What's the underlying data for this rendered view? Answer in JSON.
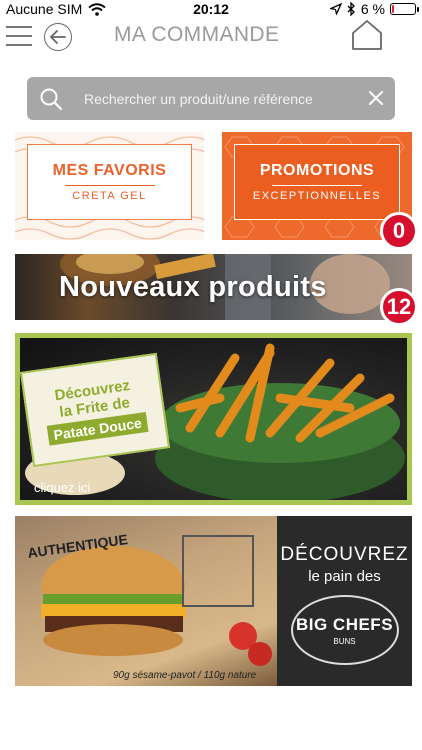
{
  "status": {
    "carrier": "Aucune SIM",
    "time": "20:12",
    "battery_pct_text": "6 %",
    "battery_level": 0.06,
    "battery_color": "#e0242b"
  },
  "header": {
    "title": "MA COMMANDE",
    "icons": [
      "menu-icon",
      "back-arrow-icon",
      "home-icon"
    ]
  },
  "search": {
    "placeholder": "Rechercher un produit/une référence"
  },
  "tiles": {
    "favorites": {
      "title": "MES FAVORIS",
      "subtitle": "CRETA GEL",
      "badge": "0"
    },
    "promotions": {
      "title": "PROMOTIONS",
      "subtitle": "EXCEPTIONNELLES"
    }
  },
  "banners": {
    "new_products": {
      "title": "Nouveaux produits",
      "badge": "12"
    },
    "frite": {
      "line1": "Découvrez",
      "line2": "la Frite de",
      "line3": "Patate Douce",
      "cta": "cliquez ici"
    },
    "big_chefs": {
      "tag": "AUTHENTIQUE",
      "weights": "90g sésame-pavot / 110g nature",
      "line1": "DÉCOUVREZ",
      "line2": "le pain des",
      "brand": "BIG CHEFS",
      "brand_sub": "BUNS"
    }
  },
  "colors": {
    "accent_orange": "#ec5e20",
    "badge_red": "#d60f2f",
    "frite_green": "#a8c552"
  }
}
